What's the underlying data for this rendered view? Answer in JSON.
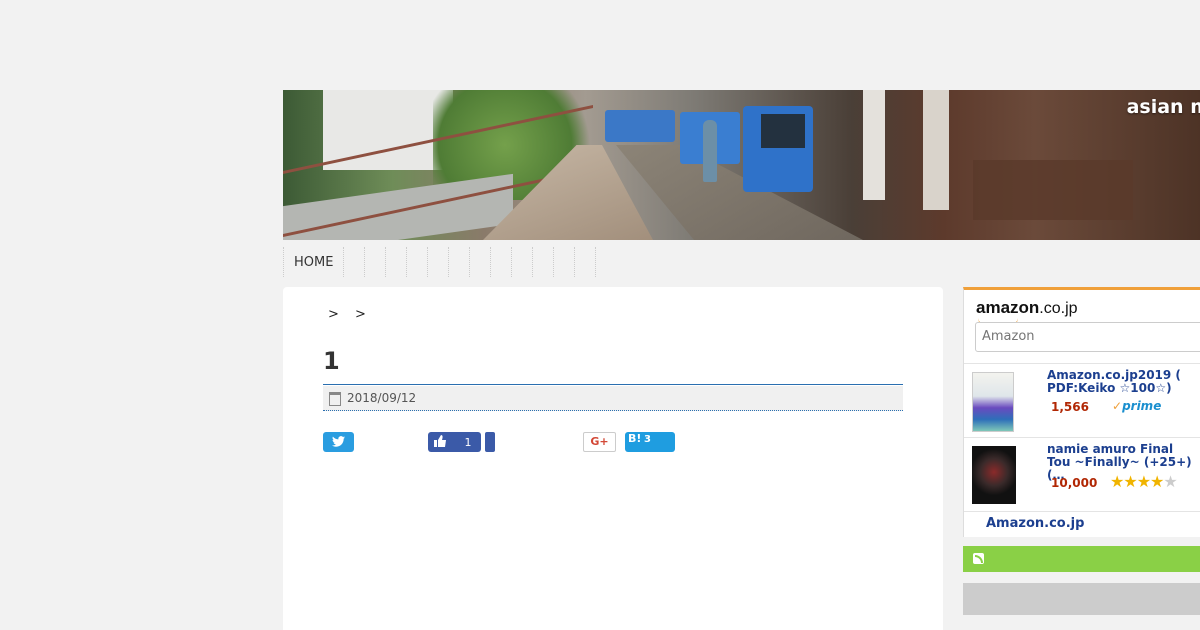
{
  "header": {
    "site_title": "asian m"
  },
  "nav": {
    "items": [
      "HOME"
    ],
    "empty_slots": 12
  },
  "post": {
    "breadcrumb": "> >",
    "title": "1",
    "date": "2018/09/12"
  },
  "share": {
    "facebook_count": "1",
    "google_label": "G+",
    "hatena_label": "B!",
    "hatena_count": "3",
    "twitter_color": "#2a9de0",
    "facebook_color": "#3b5aa8",
    "hatena_color": "#1f9de0"
  },
  "sidebar": {
    "amazon": {
      "logo_text": "amazon",
      "logo_domain": ".co.jp",
      "search_placeholder": "Amazon",
      "items": [
        {
          "title": "Amazon.co.jp2019 ( PDF:Keiko ☆100☆)",
          "price": "1,566",
          "badge": "prime"
        },
        {
          "title": "namie amuro Final Tou ~Finally~ (+25+)(…",
          "price": "10,000",
          "rating": 4
        }
      ],
      "footer_link": "Amazon.co.jp",
      "accent_color": "#f0a03a"
    },
    "rss_color": "#8ad046"
  }
}
